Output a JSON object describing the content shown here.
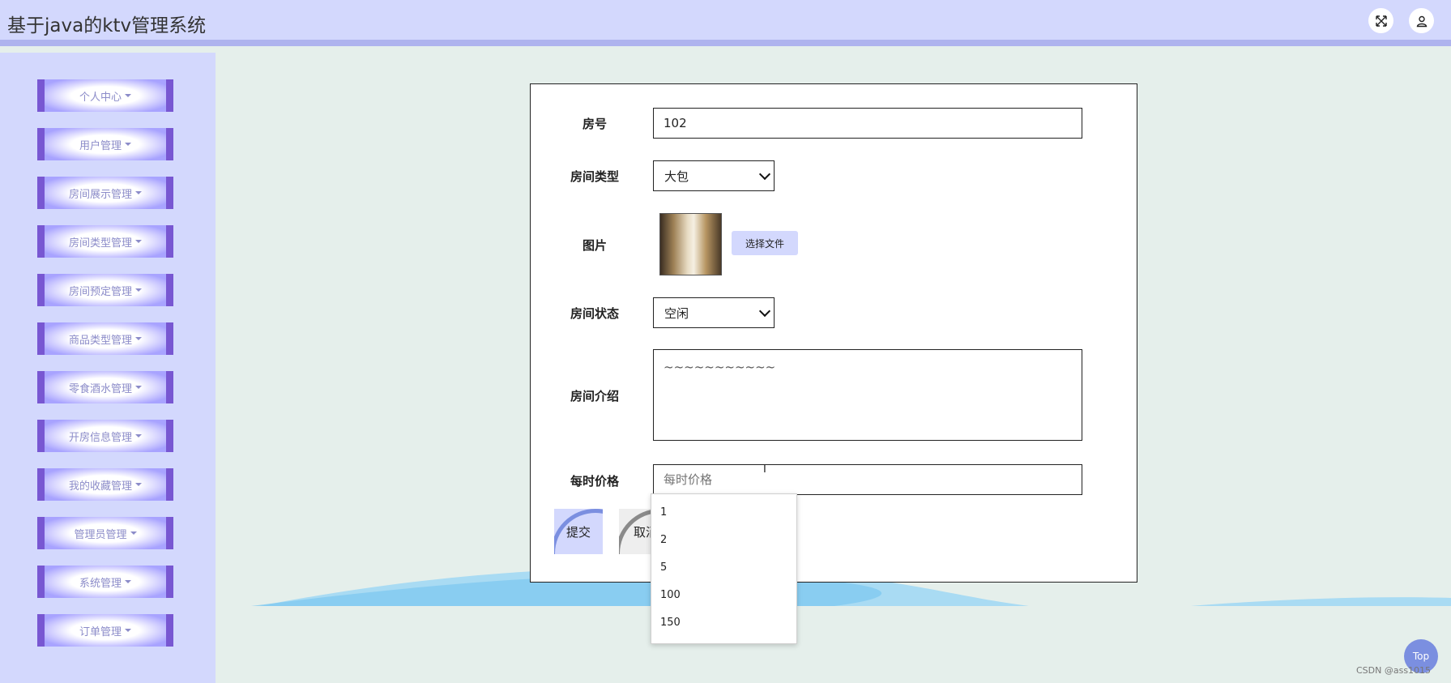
{
  "header": {
    "title": "基于java的ktv管理系统"
  },
  "sidebar": {
    "items": [
      {
        "label": "个人中心"
      },
      {
        "label": "用户管理"
      },
      {
        "label": "房间展示管理"
      },
      {
        "label": "房间类型管理"
      },
      {
        "label": "房间预定管理"
      },
      {
        "label": "商品类型管理"
      },
      {
        "label": "零食酒水管理"
      },
      {
        "label": "开房信息管理"
      },
      {
        "label": "我的收藏管理"
      },
      {
        "label": "管理员管理"
      },
      {
        "label": "系统管理"
      },
      {
        "label": "订单管理"
      }
    ]
  },
  "form": {
    "room_no": {
      "label": "房号",
      "value": "102"
    },
    "room_type": {
      "label": "房间类型",
      "value": "大包"
    },
    "image": {
      "label": "图片",
      "button": "选择文件"
    },
    "room_status": {
      "label": "房间状态",
      "value": "空闲"
    },
    "intro": {
      "label": "房间介绍",
      "value": "~~~~~~~~~~~"
    },
    "price": {
      "label": "每时价格",
      "placeholder": "每时价格",
      "value": ""
    },
    "submit_label": "提交",
    "cancel_label": "取消"
  },
  "autocomplete": {
    "options": [
      "1",
      "2",
      "5",
      "100",
      "150"
    ]
  },
  "top_button": "Top",
  "watermark": "CSDN @ass1015",
  "colors": {
    "header_bg": "#d3d8fd",
    "menu_border": "#7857d2",
    "accent": "#7b8fe0",
    "content_bg": "#e5efeb"
  },
  "icons": {
    "fullscreen": "fullscreen-icon",
    "user": "user-icon"
  }
}
